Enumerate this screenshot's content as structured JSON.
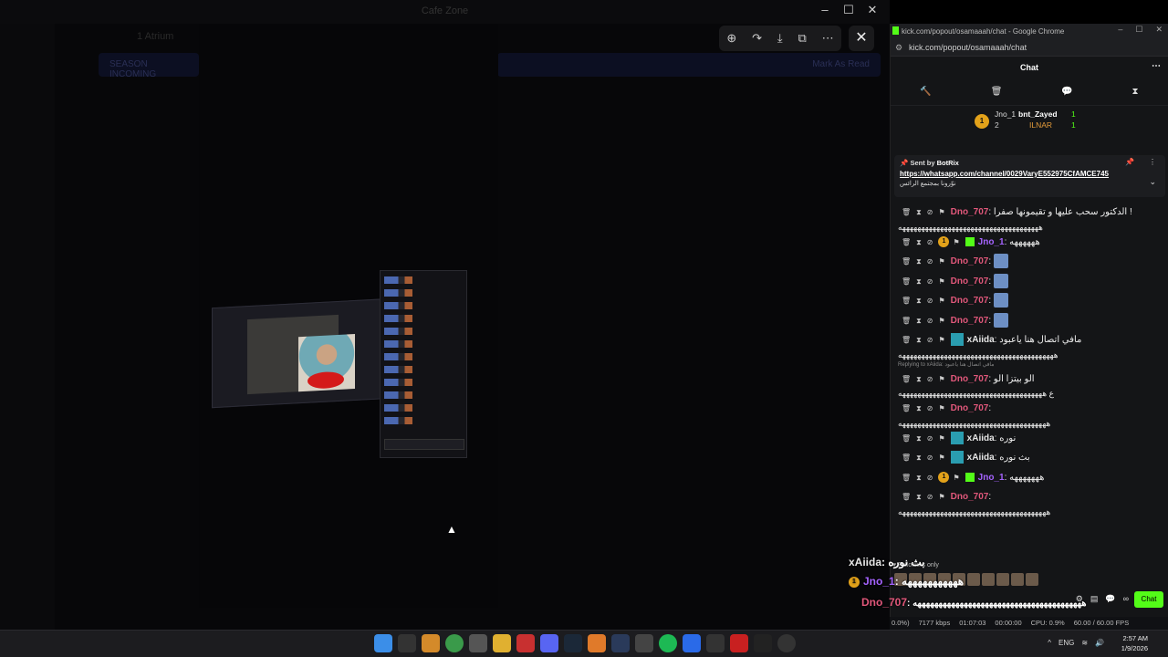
{
  "background_app": {
    "title": "Cafe Zone",
    "channel_label": "1 Atrium",
    "banner_left": "SEASON INCOMING",
    "banner_right": "Mark As Read"
  },
  "viewer": {
    "toolbar_icons": [
      "zoom-in-icon",
      "rotate-icon",
      "download-icon",
      "open-external-icon",
      "more-icon"
    ],
    "close_label": "✕"
  },
  "chrome": {
    "window_title": "kick.com/popout/osamaaah/chat - Google Chrome",
    "url": "kick.com/popout/osamaaah/chat"
  },
  "chat": {
    "header": "Chat",
    "gifters": [
      {
        "name": "Jno_1",
        "count": "1",
        "rank": "1",
        "color": "#ffd25a"
      },
      {
        "name": "bnt_Zayed",
        "count": "1",
        "rank": "",
        "color": "#ffffff"
      },
      {
        "name": "ILNAR",
        "count": "1",
        "rank": "2",
        "color": "#e39a3a"
      }
    ],
    "pinned": {
      "sent_by": "Sent by",
      "bot": "BotRix",
      "link": "https://whatsapp.com/channel/0029VaryE552975CfAMCE745",
      "arabic": "نوّرونا بمجتمع الرائس"
    },
    "messages": [
      {
        "user": "Dno_707",
        "color": "#e0577a",
        "text": "الدكتور سحب عليها و تقيمونها صفرا !",
        "cont": "هههههههههههههههههههههههههههههههههههههه"
      },
      {
        "user": "Jno_1",
        "color": "#a563ff",
        "text": "ههههههه",
        "cont": "",
        "gold": true
      },
      {
        "user": "Dno_707",
        "color": "#e0577a",
        "text": "",
        "cont": "",
        "emote": true
      },
      {
        "user": "Dno_707",
        "color": "#e0577a",
        "text": "",
        "cont": "",
        "emote": true
      },
      {
        "user": "Dno_707",
        "color": "#e0577a",
        "text": "",
        "cont": "",
        "emote": true
      },
      {
        "user": "Dno_707",
        "color": "#e0577a",
        "text": "",
        "cont": "",
        "emote": true
      },
      {
        "user": "xAiida",
        "color": "#e6e6e6",
        "text": "مافي اتصال هنا ياعبود",
        "cont": "هههههههههههههههههههههههههههههههههههههههههه",
        "sub": true
      },
      {
        "user": "Dno_707",
        "color": "#e0577a",
        "text": "الو بيتزا الو",
        "cont": "ع ههههههههههههههههههههههههههههههههههههههه",
        "reply": "Replying to xAiida: مافي اتصال هنا ياعبود"
      },
      {
        "user": "Dno_707",
        "color": "#e0577a",
        "text": "",
        "cont": "هههههههههههههههههههههههههههههههههههههههه"
      },
      {
        "user": "xAiida",
        "color": "#e6e6e6",
        "text": "نوره",
        "cont": "",
        "sub": true
      },
      {
        "user": "xAiida",
        "color": "#e6e6e6",
        "text": "بث نوره",
        "cont": "",
        "sub": true
      },
      {
        "user": "Jno_1",
        "color": "#a563ff",
        "text": "هههههههه",
        "cont": "",
        "gold": true
      },
      {
        "user": "Dno_707",
        "color": "#e0577a",
        "text": "",
        "cont": "هههههههههههههههههههههههههههههههههههههههه"
      }
    ],
    "followers_only": "Followers only",
    "chat_button": "Chat"
  },
  "overlay_lines": [
    {
      "user": "xAiida",
      "text": ": بث نوره",
      "color": "#e6e6e6"
    },
    {
      "user": "Jno_1",
      "text": ": هههههههههههه",
      "color": "#a563ff"
    },
    {
      "user": "Dno_707",
      "text": ": ههههههههههههههههههههههههههههههههههههههههه",
      "color": "#e0577a"
    }
  ],
  "stats": {
    "cpu_pct": "0.0%)",
    "bitrate": "7177 kbps",
    "stream_time": "01:07:03",
    "rec_time": "00:00:00",
    "cpu": "CPU: 0.9%",
    "fps": "60.00 / 60.00 FPS"
  },
  "taskbar": {
    "lang": "ENG",
    "time": "2:57 AM",
    "date": "1/9/2026"
  },
  "colors": {
    "kick_green": "#53fc18",
    "gold": "#e3a21a"
  }
}
